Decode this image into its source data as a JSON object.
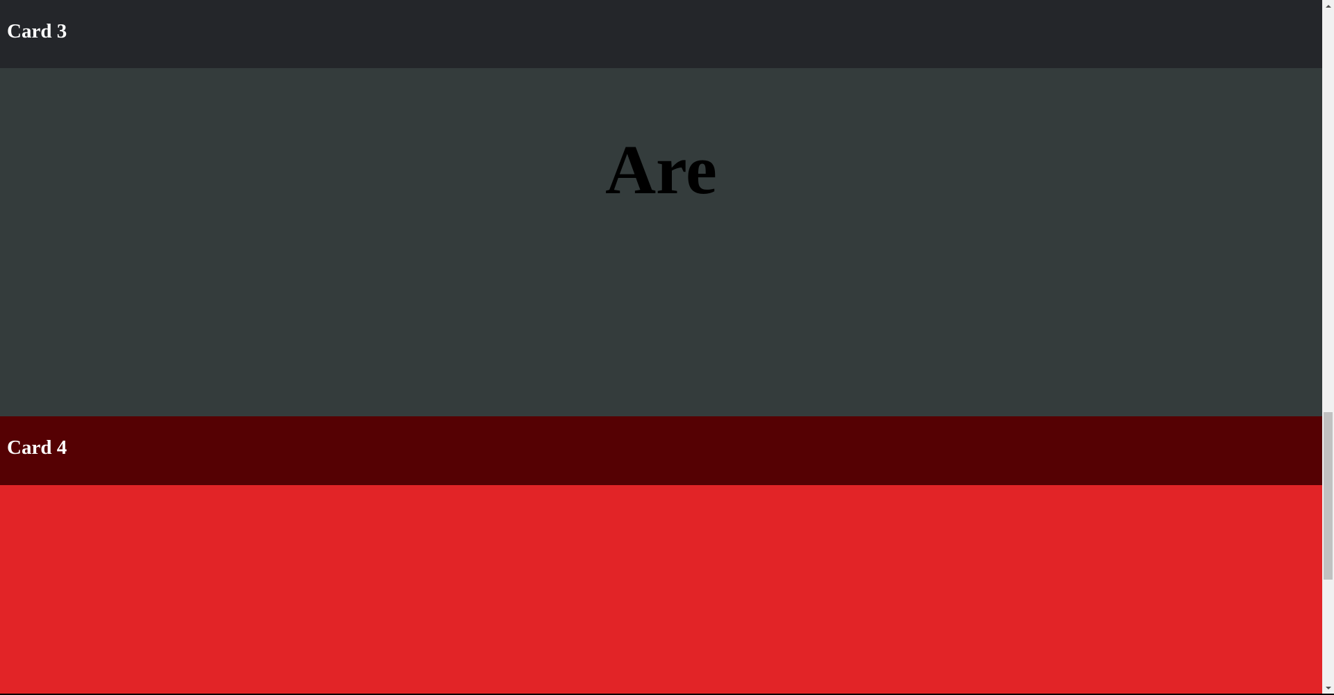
{
  "cards": [
    {
      "title": "Card 3",
      "header_color": "#24262a",
      "body_color": "#343c3c",
      "body_text": "Are"
    },
    {
      "title": "Card 4",
      "header_color": "#550103",
      "body_color": "#e22427",
      "body_text": ""
    }
  ],
  "scrollbar": {
    "up_icon": "arrow-up-icon",
    "down_icon": "arrow-down-icon",
    "scroll_position_fraction": 0.76
  }
}
